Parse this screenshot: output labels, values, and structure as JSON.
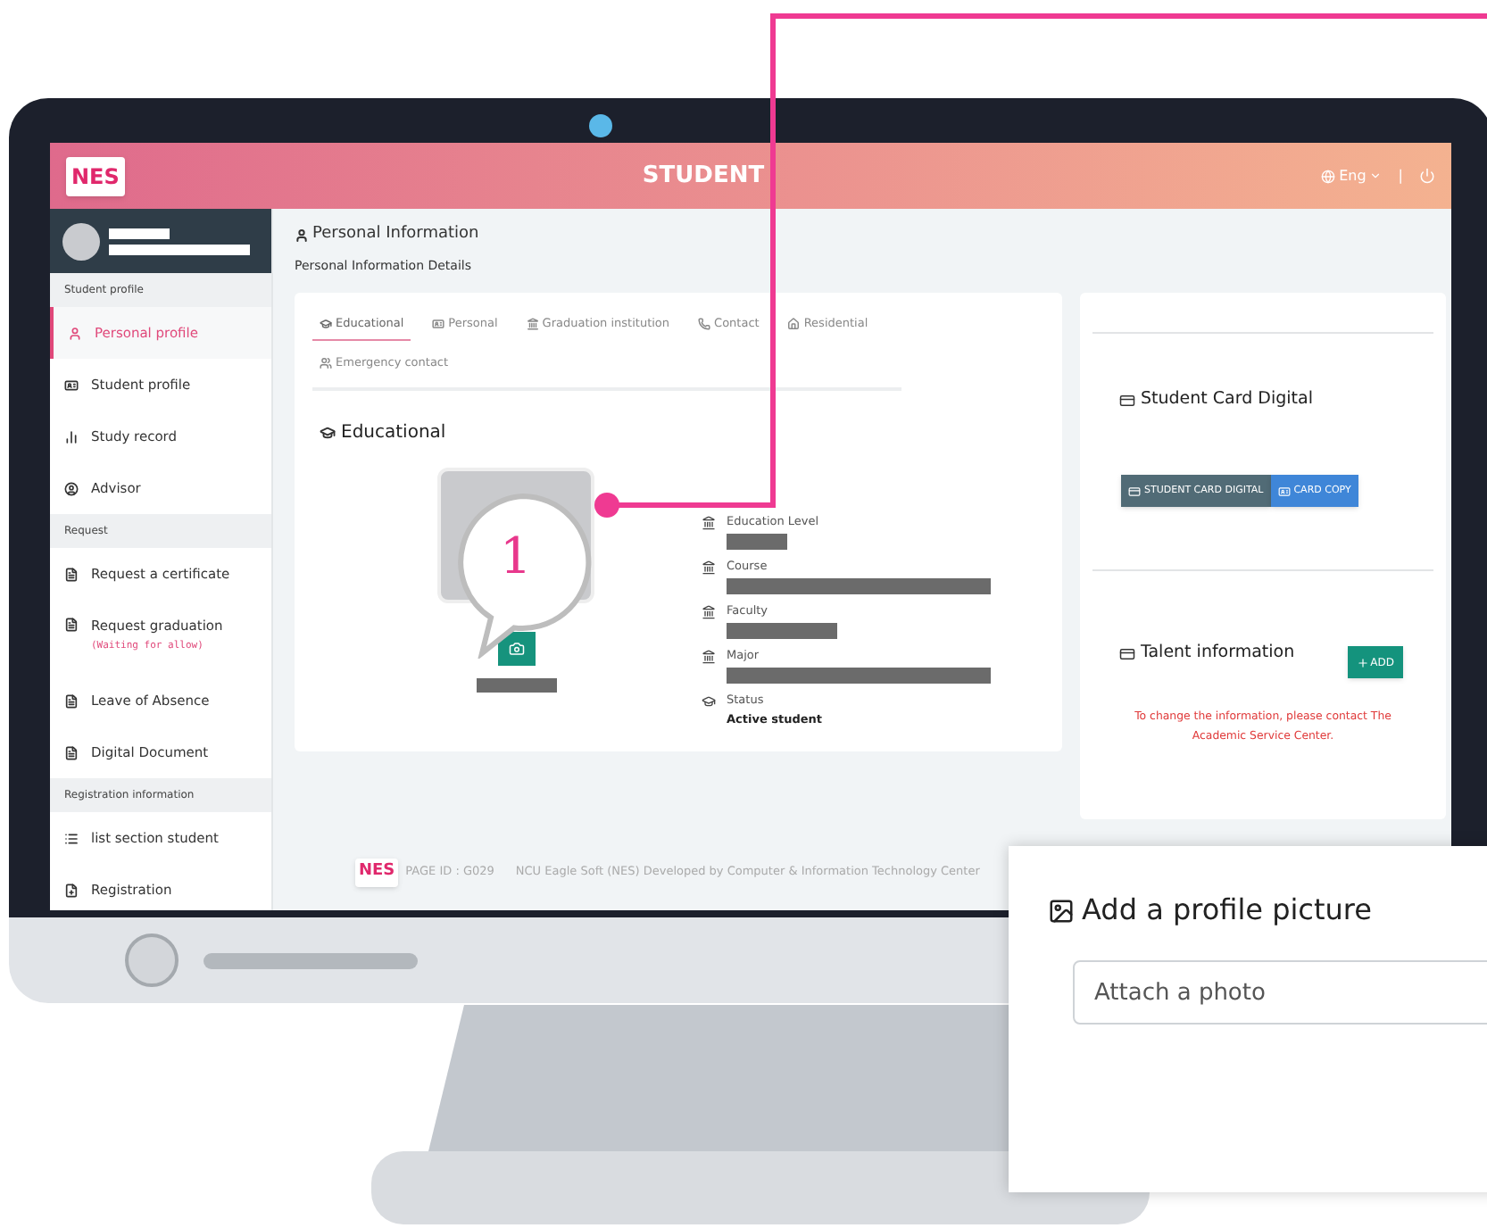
{
  "header": {
    "logo": "NES",
    "title": "STUDENT",
    "language": "Eng",
    "separator": "|"
  },
  "sidebar": {
    "sections": [
      {
        "label": "Student profile",
        "items": [
          {
            "label": "Personal profile",
            "selected": true
          },
          {
            "label": "Student profile",
            "selected": false
          },
          {
            "label": "Study record",
            "selected": false
          },
          {
            "label": "Advisor",
            "selected": false
          }
        ]
      },
      {
        "label": "Request",
        "items": [
          {
            "label": "Request a certificate",
            "selected": false
          },
          {
            "label": "Request graduation",
            "note": "(Waiting for allow)",
            "selected": false
          },
          {
            "label": "Leave of Absence",
            "selected": false
          },
          {
            "label": "Digital Document",
            "selected": false
          }
        ]
      },
      {
        "label": "Registration information",
        "items": [
          {
            "label": "list section student",
            "selected": false
          },
          {
            "label": "Registration",
            "selected": false
          }
        ]
      }
    ]
  },
  "page": {
    "title": "Personal Information",
    "subtitle": "Personal Information Details"
  },
  "tabs": [
    {
      "label": "Educational",
      "selected": true
    },
    {
      "label": "Personal",
      "selected": false
    },
    {
      "label": "Graduation institution",
      "selected": false
    },
    {
      "label": "Contact",
      "selected": false
    },
    {
      "label": "Residential",
      "selected": false
    },
    {
      "label": "Emergency contact",
      "selected": false
    }
  ],
  "section_title": "Educational",
  "fields": [
    {
      "label": "Education Level",
      "kind": "redacted"
    },
    {
      "label": "Course",
      "kind": "redacted"
    },
    {
      "label": "Faculty",
      "kind": "redacted"
    },
    {
      "label": "Major",
      "kind": "redacted"
    },
    {
      "label": "Status",
      "kind": "text",
      "value": "Active student"
    }
  ],
  "student_card": {
    "title": "Student Card Digital",
    "buttons": [
      {
        "label": "STUDENT CARD DIGITAL",
        "kind": "dark"
      },
      {
        "label": "CARD COPY",
        "kind": "primary"
      }
    ]
  },
  "talent": {
    "title": "Talent information",
    "add_button": "ADD",
    "note": "To change the information, please contact The Academic Service Center."
  },
  "footer": {
    "logo": "NES",
    "page_id": "PAGE ID : G029",
    "credit": "NCU Eagle Soft (NES) Developed by Computer & Information Technology Center"
  },
  "callout": {
    "number": "1"
  },
  "popup": {
    "title": "Add a profile picture",
    "placeholder": "Attach a photo"
  }
}
